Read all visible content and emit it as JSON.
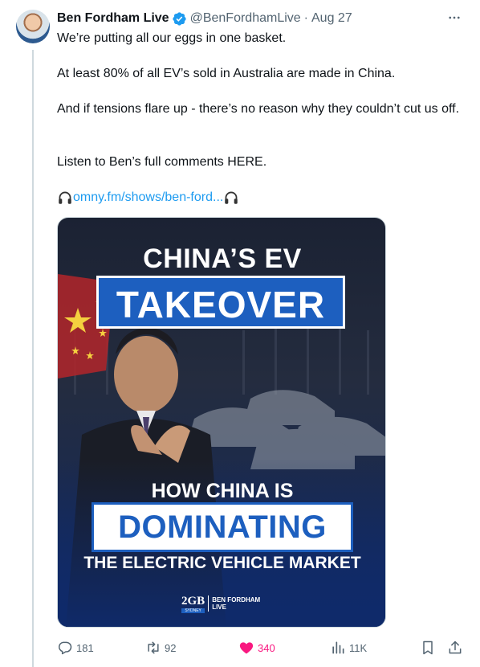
{
  "tweet": {
    "author_name": "Ben Fordham Live",
    "handle": "@BenFordhamLive",
    "separator": "·",
    "date": "Aug 27",
    "text": {
      "line1": "We’re putting all our eggs in one basket.",
      "line2": "At least 80% of all EV’s sold in Australia are made in China.",
      "line3": "And if tensions flare up - there’s no reason why they couldn’t cut us off.",
      "line4": "Listen to Ben’s full comments HERE.",
      "link": "omny.fm/shows/ben-ford..."
    },
    "media": {
      "headline_top": "CHINA’S EV",
      "headline_boxed": "TAKEOVER",
      "sub_top": "HOW CHINA IS",
      "sub_boxed": "DOMINATING",
      "sub_bottom": "THE ELECTRIC VEHICLE MARKET",
      "brand_logo": "2GB",
      "brand_sub": "SYDNEY",
      "brand_line1": "BEN FORDHAM",
      "brand_line2": "LIVE"
    },
    "stats": {
      "replies": "181",
      "retweets": "92",
      "likes": "340",
      "views": "11K"
    }
  },
  "colors": {
    "accent": "#1d9bf0",
    "like": "#f91880",
    "muted": "#536471",
    "brand_blue": "#1d5fbf"
  },
  "icons": [
    "verified-badge-icon",
    "more-icon",
    "headphones-icon",
    "reply-icon",
    "retweet-icon",
    "heart-icon",
    "views-icon",
    "bookmark-icon",
    "share-icon"
  ]
}
